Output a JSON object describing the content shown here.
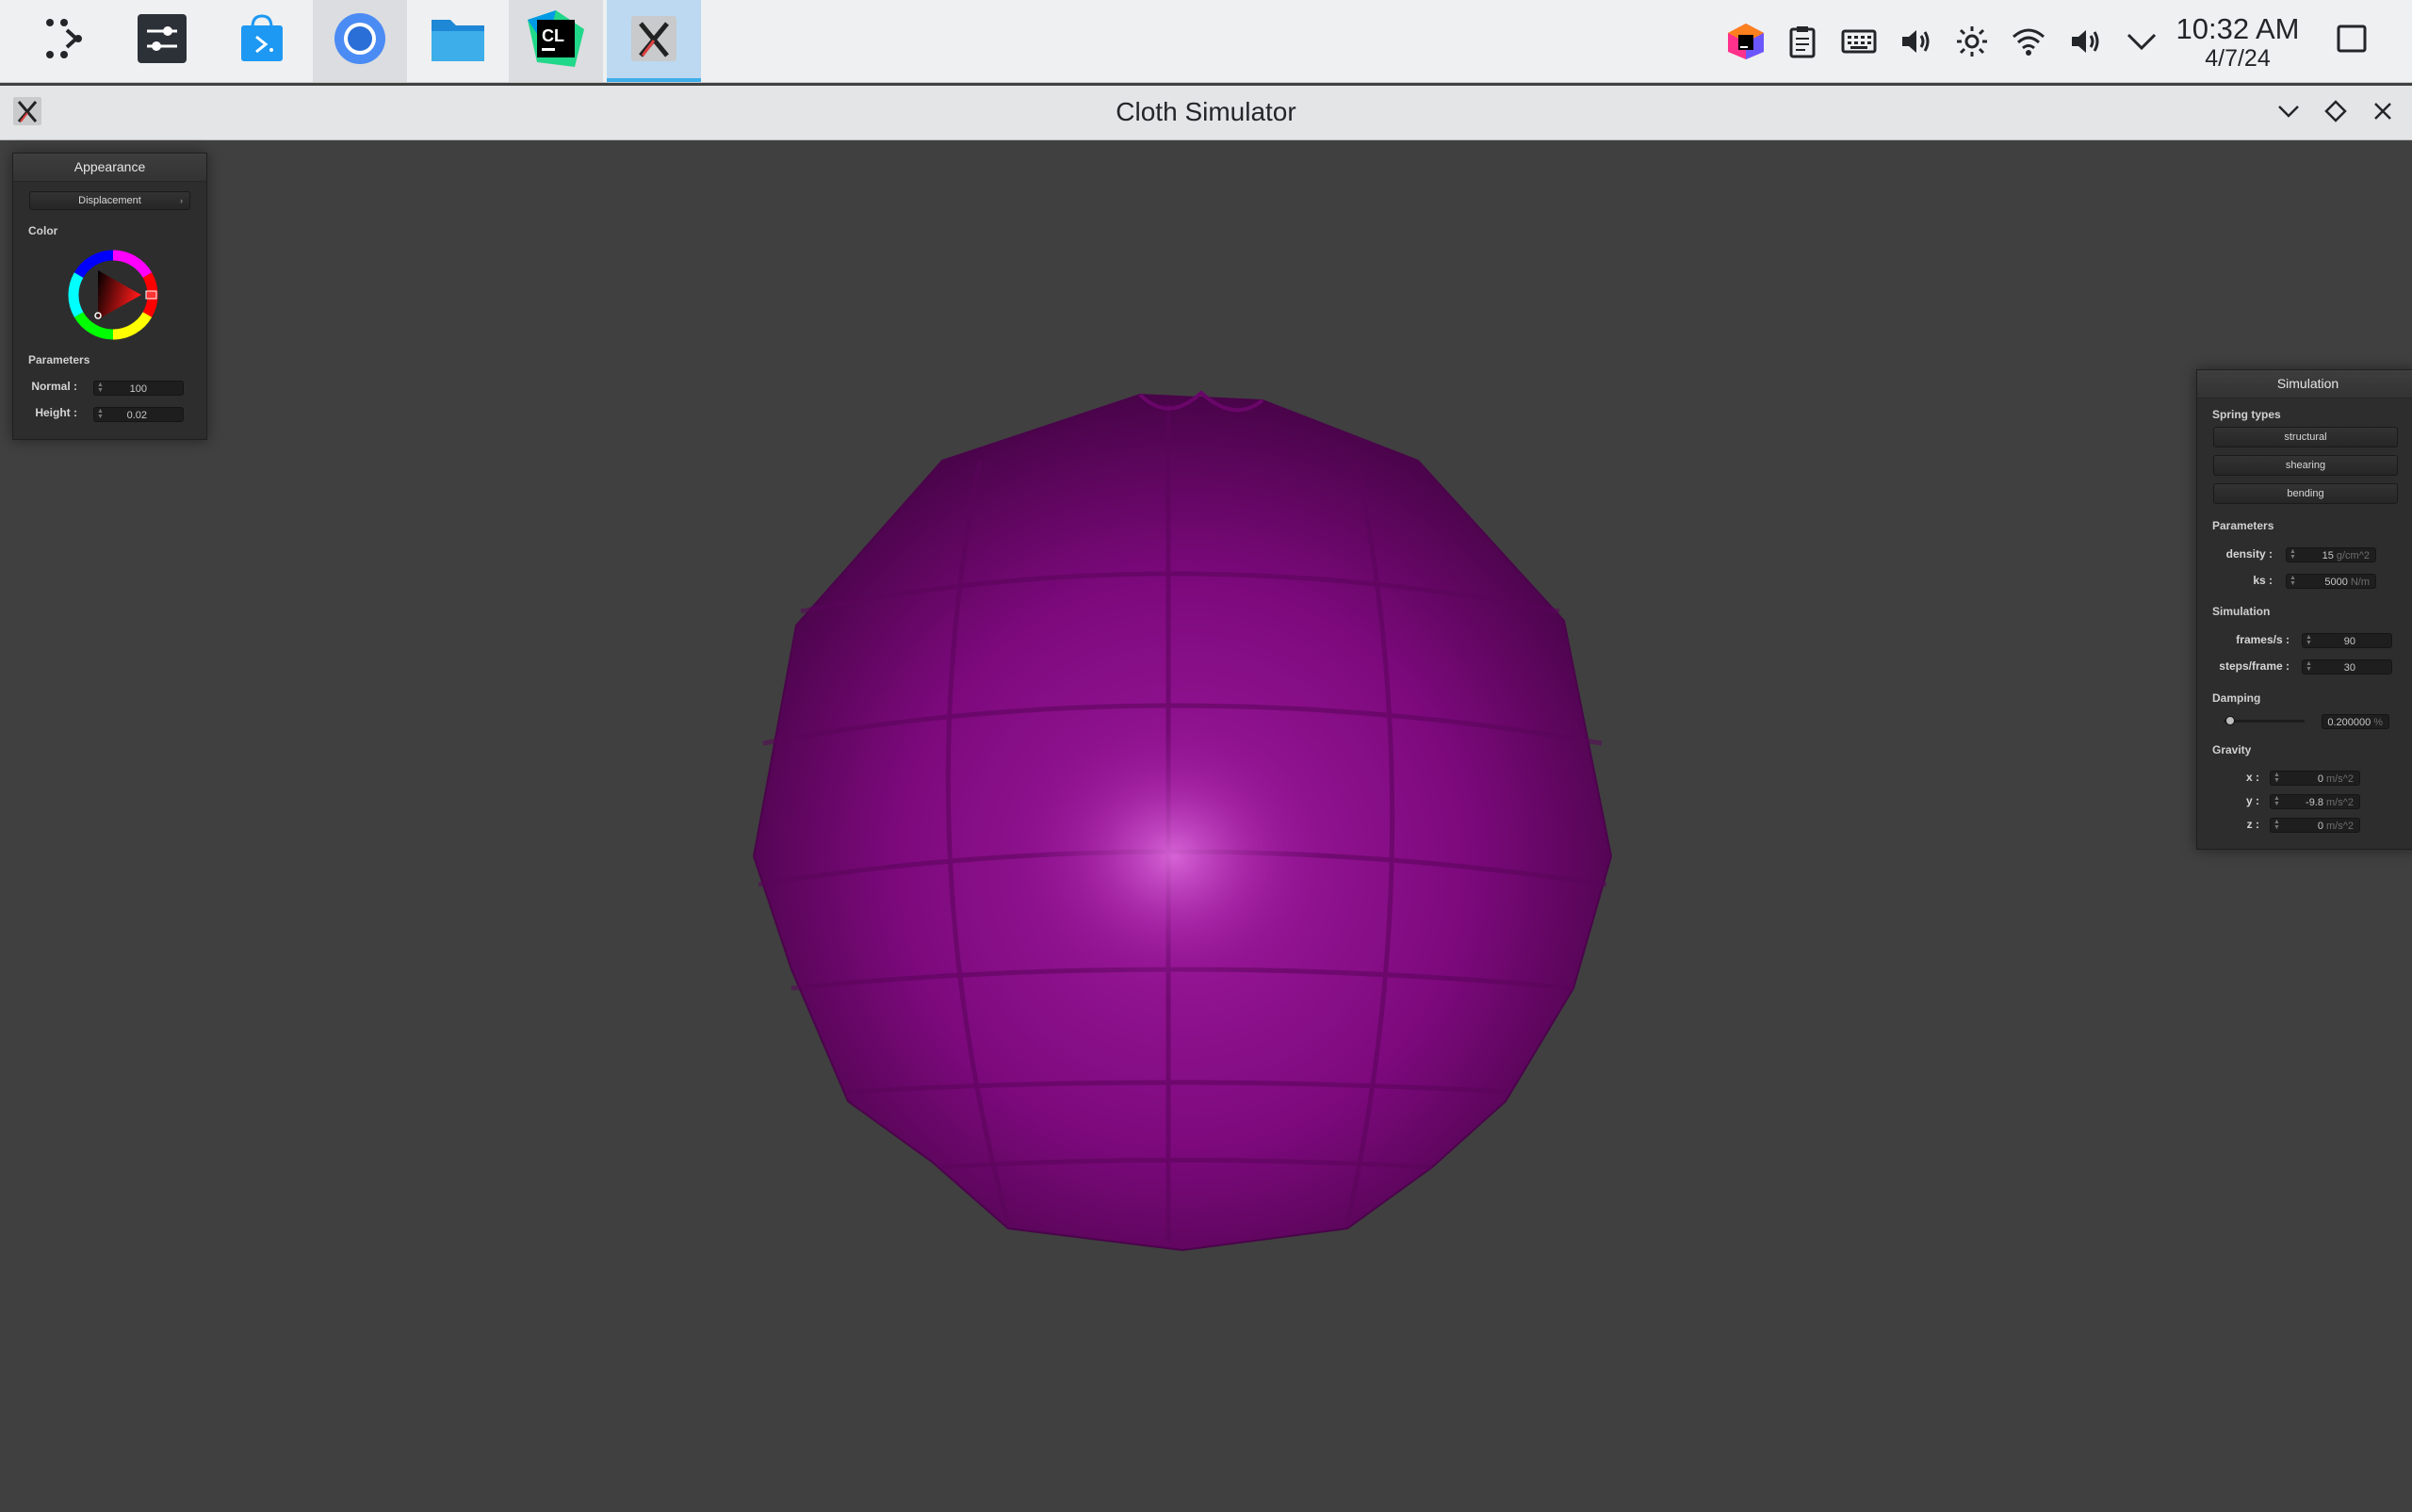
{
  "taskbar": {
    "launcher": "launcher-icon",
    "apps": [
      {
        "name": "System Settings",
        "icon": "settings-sliders-icon"
      },
      {
        "name": "Discover",
        "icon": "store-bag-icon"
      },
      {
        "name": "Chromium",
        "icon": "browser-icon"
      },
      {
        "name": "Files",
        "icon": "folder-icon"
      },
      {
        "name": "CLion",
        "icon": "clion-icon"
      },
      {
        "name": "X11 App",
        "icon": "x-logo-icon"
      }
    ],
    "tray_icons": [
      "jetbrains-toolbox-icon",
      "clipboard-icon",
      "keyboard-icon",
      "volume-icon",
      "brightness-icon",
      "wifi-icon",
      "speaker-icon",
      "chevron-down-icon"
    ],
    "clock": {
      "time": "10:32 AM",
      "date": "4/7/24"
    },
    "show_desktop_icon": "show-desktop-icon"
  },
  "window": {
    "title": "Cloth Simulator",
    "controls": [
      "minimize-icon",
      "maximize-icon",
      "close-icon"
    ]
  },
  "appearance_panel": {
    "title": "Appearance",
    "shader_dropdown": "Displacement",
    "color_label": "Color",
    "color_value": "#8b0e8b",
    "parameters_label": "Parameters",
    "normal_label": "Normal :",
    "normal_value": "100",
    "height_label": "Height :",
    "height_value": "0.02"
  },
  "simulation_panel": {
    "title": "Simulation",
    "spring_types_label": "Spring types",
    "spring_buttons": [
      "structural",
      "shearing",
      "bending"
    ],
    "parameters_label": "Parameters",
    "density_label": "density :",
    "density_value": "15",
    "density_unit": "g/cm^2",
    "ks_label": "ks :",
    "ks_value": "5000",
    "ks_unit": "N/m",
    "simulation_label": "Simulation",
    "fps_label": "frames/s :",
    "fps_value": "90",
    "steps_label": "steps/frame :",
    "steps_value": "30",
    "damping_label": "Damping",
    "damping_value": "0.200000",
    "damping_unit": "%",
    "damping_fraction": 0.2,
    "gravity_label": "Gravity",
    "gx_label": "x :",
    "gx_value": "0",
    "gy_label": "y :",
    "gy_value": "-9.8",
    "gz_label": "z :",
    "gz_value": "0",
    "gravity_unit": "m/s^2"
  }
}
